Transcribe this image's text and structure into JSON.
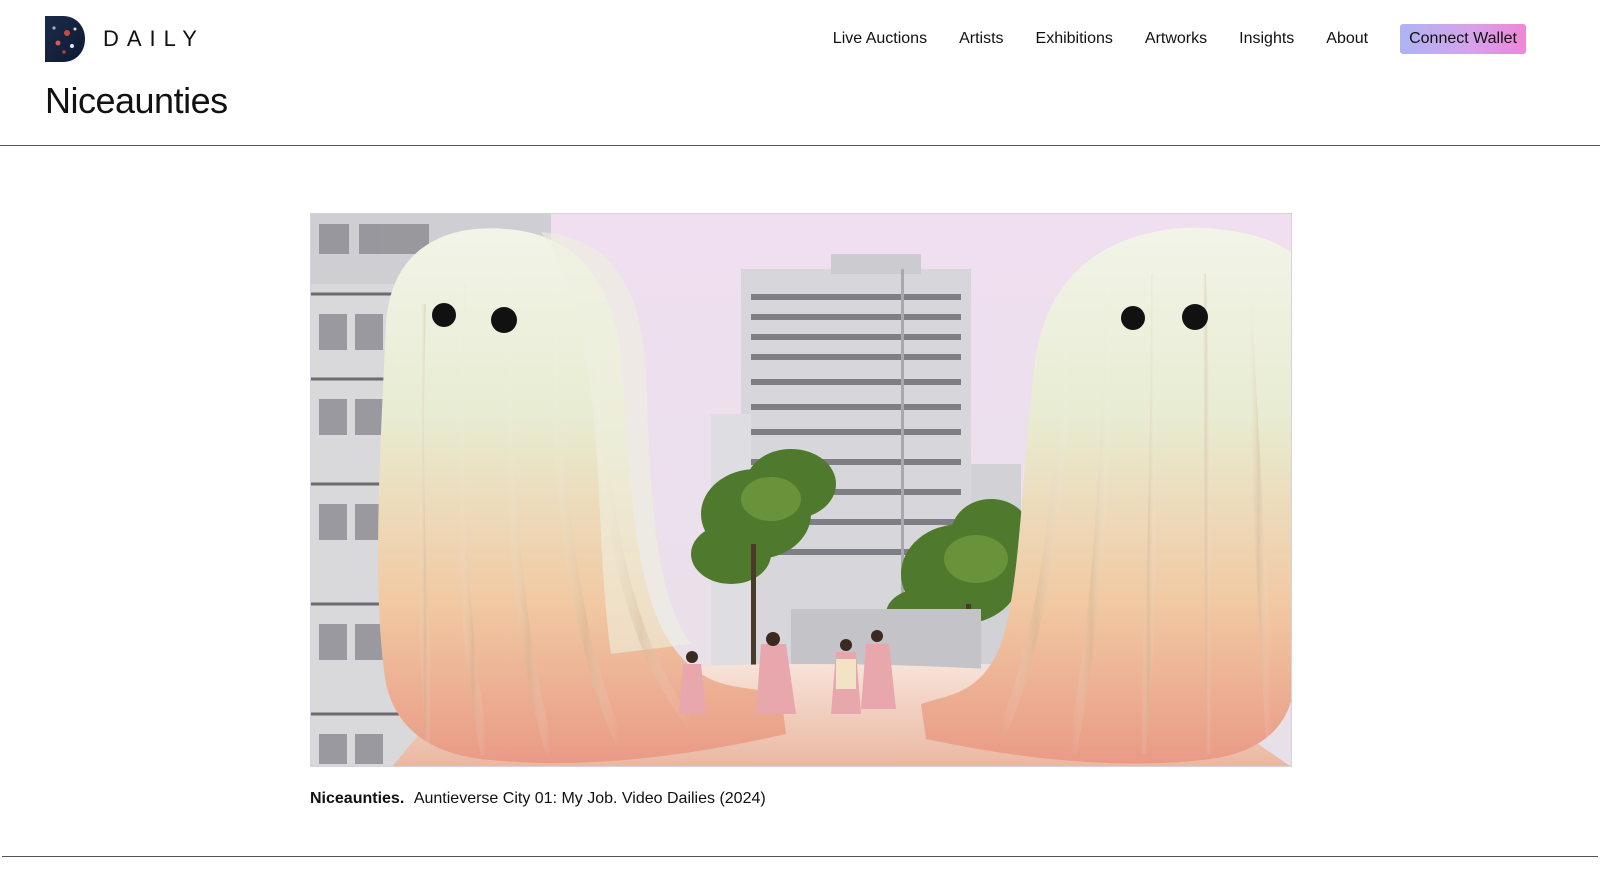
{
  "header": {
    "logo_text": "DAILY",
    "logo_icon": "daily-d-logo-icon",
    "nav": [
      {
        "label": "Live Auctions"
      },
      {
        "label": "Artists"
      },
      {
        "label": "Exhibitions"
      },
      {
        "label": "Artworks"
      },
      {
        "label": "Insights"
      },
      {
        "label": "About"
      }
    ],
    "wallet_label": "Connect Wallet",
    "wallet_gradient": [
      "#aeb4f2",
      "#ef86d9"
    ]
  },
  "page": {
    "title": "Niceaunties"
  },
  "artwork": {
    "artist": "Niceaunties.",
    "description": "Auntieverse City 01: My Job. Video Dailies (2024)"
  },
  "colors": {
    "text": "#111111",
    "divider": "#555555",
    "background": "#ffffff"
  }
}
